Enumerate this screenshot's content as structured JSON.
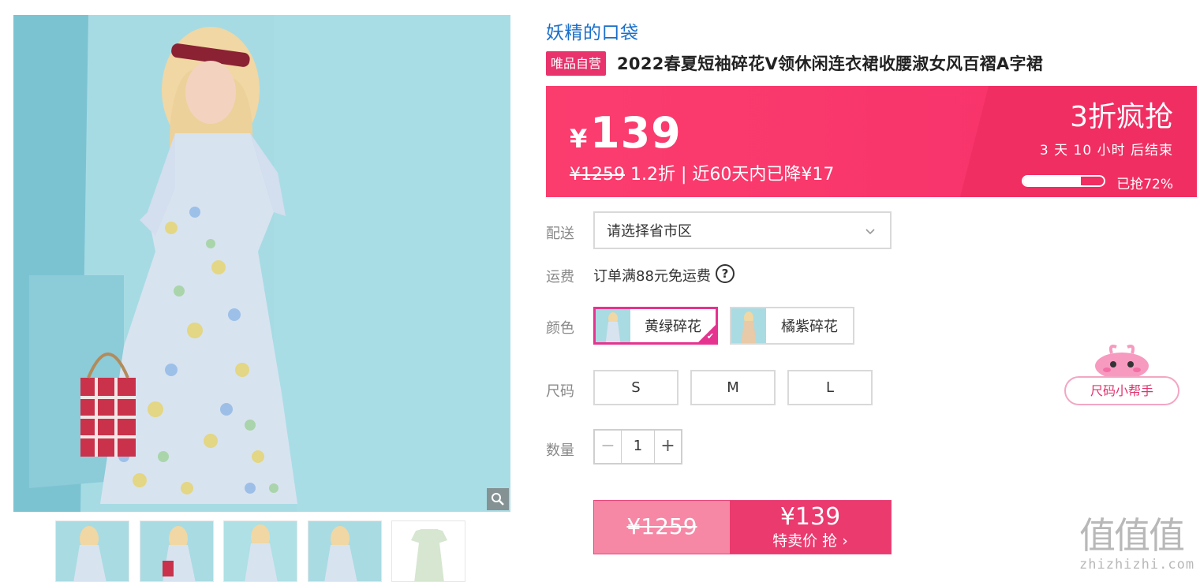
{
  "brand": "妖精的口袋",
  "badge": "唯品自营",
  "title": "2022春夏短袖碎花V领休闲连衣裙收腰淑女风百褶A字裙",
  "price": {
    "currency": "¥",
    "current": "139",
    "original": "¥1259",
    "discount": "1.2折",
    "separator": " | ",
    "drop_note": "近60天内已降¥17"
  },
  "promo": {
    "title": "3折疯抢",
    "countdown": "3 天 10 小时 后结束",
    "sold_percent": 72,
    "sold_label": "已抢72%"
  },
  "labels": {
    "delivery": "配送",
    "shipping": "运费",
    "color": "颜色",
    "size": "尺码",
    "quantity": "数量"
  },
  "delivery": {
    "placeholder": "请选择省市区"
  },
  "shipping": {
    "text": "订单满88元免运费",
    "help": "?"
  },
  "colors": [
    {
      "label": "黄绿碎花",
      "selected": true
    },
    {
      "label": "橘紫碎花",
      "selected": false
    }
  ],
  "sizes": [
    "S",
    "M",
    "L"
  ],
  "quantity": {
    "minus": "−",
    "value": "1",
    "plus": "+"
  },
  "buy": {
    "original": "¥1259",
    "price": "¥139",
    "action": "特卖价 抢",
    "arrow": "›"
  },
  "size_helper": {
    "label": "尺码小帮手"
  },
  "watermark": {
    "glyphs": "值值值",
    "url": "zhizhizhi.com"
  },
  "colors_theme": {
    "brand_link": "#1a6fc9",
    "accent_pink": "#f6306a",
    "selected_border": "#e5338f"
  },
  "icons": [
    "zoom-icon",
    "chevron-down-icon",
    "help-icon",
    "check-icon",
    "mascot-icon"
  ]
}
